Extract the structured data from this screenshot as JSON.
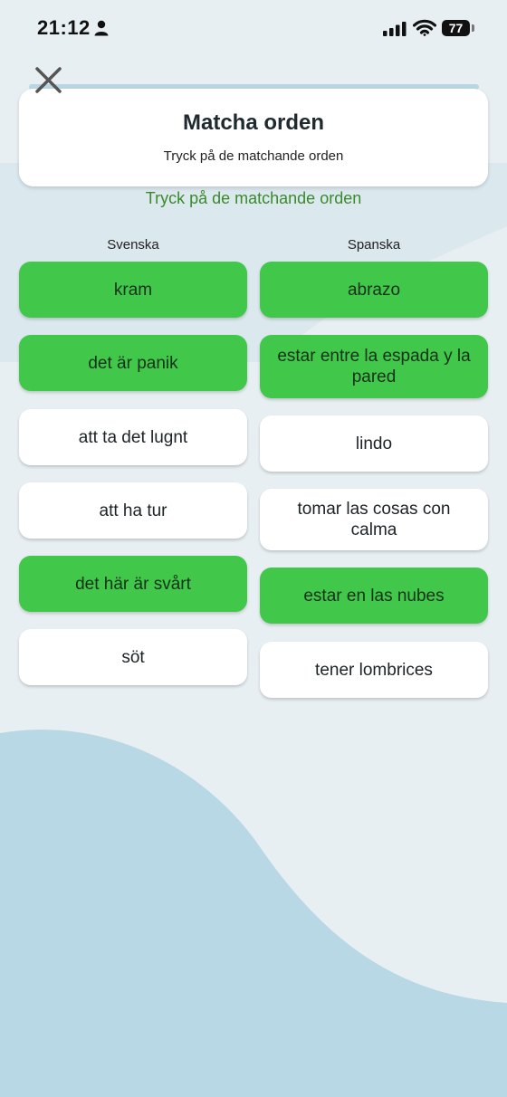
{
  "status_bar": {
    "time": "21:12",
    "battery": "77"
  },
  "header": {
    "title": "Matcha orden",
    "subtitle": "Tryck på de matchande orden"
  },
  "instruction": "Tryck på de matchande orden",
  "columns": {
    "left_title": "Svenska",
    "right_title": "Spanska"
  },
  "left_words": [
    {
      "label": "kram",
      "state": "matched"
    },
    {
      "label": "det är panik",
      "state": "matched"
    },
    {
      "label": "att ta det lugnt",
      "state": "unmatched"
    },
    {
      "label": "att ha tur",
      "state": "unmatched"
    },
    {
      "label": "det här är svårt",
      "state": "matched"
    },
    {
      "label": "söt",
      "state": "unmatched"
    }
  ],
  "right_words": [
    {
      "label": "abrazo",
      "state": "matched"
    },
    {
      "label": "estar entre la espada y la pared",
      "state": "matched"
    },
    {
      "label": "lindo",
      "state": "unmatched"
    },
    {
      "label": "tomar las cosas con calma",
      "state": "unmatched"
    },
    {
      "label": "estar en las nubes",
      "state": "matched"
    },
    {
      "label": "tener lombrices",
      "state": "unmatched"
    }
  ],
  "colors": {
    "matched": "#41c74a",
    "unmatched": "#ffffff",
    "instruction": "#3a8a2c",
    "background": "#e8eff2",
    "wave": "#b7d8e4"
  },
  "icons": {
    "close": "close-icon",
    "person": "person-icon",
    "signal": "cellular-signal-icon",
    "wifi": "wifi-icon",
    "battery": "battery-icon"
  }
}
